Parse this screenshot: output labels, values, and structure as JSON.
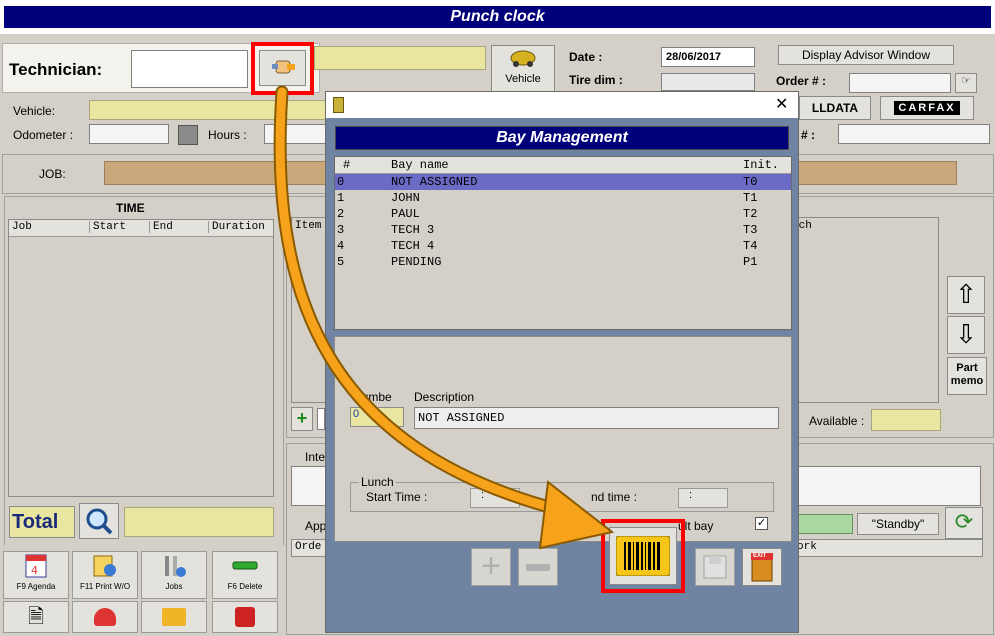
{
  "app": {
    "title": "Punch clock"
  },
  "header": {
    "technician_label": "Technician:",
    "technician_value": "",
    "vehicle_label": "Vehicle",
    "date_label": "Date :",
    "date_value": "28/06/2017",
    "tire_dim_label": "Tire dim :",
    "order_label": "Order # :",
    "display_advisor_button": "Display Advisor Window",
    "alldata_label": "LLDATA",
    "carfax_label": "CARFAX",
    "hash_label": "# :"
  },
  "vehicle_row": {
    "vehicle_label": "Vehicle:",
    "odometer_label": "Odometer :",
    "hours_label": "Hours :"
  },
  "job_row": {
    "label": "JOB:"
  },
  "time_panel": {
    "title": "TIME",
    "columns": [
      "Job",
      "Start",
      "End",
      "Duration"
    ],
    "total_label": "Total"
  },
  "items_panel": {
    "item_col": "Item",
    "tech_col": "ech",
    "part_memo": "Part memo",
    "available_label": "Available :",
    "standby_button": "\"Standby\"",
    "int_label": "Inte",
    "app_label": "App",
    "order_col": "Orde",
    "work_col": "ork"
  },
  "toolbar": {
    "agenda": "F9 Agenda",
    "print_wo": "F11 Print W/O",
    "jobs": "Jobs",
    "delete": "F6 Delete"
  },
  "dialog": {
    "title": "Bay Management",
    "columns": {
      "num": "#",
      "name": "Bay name",
      "init": "Init."
    },
    "rows": [
      {
        "num": "0",
        "name": "NOT ASSIGNED",
        "init": "T0"
      },
      {
        "num": "1",
        "name": "JOHN",
        "init": "T1"
      },
      {
        "num": "2",
        "name": "PAUL",
        "init": "T2"
      },
      {
        "num": "3",
        "name": "TECH 3",
        "init": "T3"
      },
      {
        "num": "4",
        "name": "TECH 4",
        "init": "T4"
      },
      {
        "num": "5",
        "name": "PENDING",
        "init": "P1"
      }
    ],
    "number_label": "Numbe",
    "number_value": "0",
    "description_label": "Description",
    "description_value": "NOT ASSIGNED",
    "lunch_label": "Lunch",
    "start_time_label": "Start Time :",
    "start_time_value": ":",
    "end_time_label": "nd time :",
    "end_time_value": ":",
    "default_bay_label": "ult bay",
    "default_bay_checked": "✓",
    "exit_label": "EXIT"
  },
  "colors": {
    "title_bg": "#00007a",
    "highlight_row": "#6b6bc6",
    "annotation_arrow": "#f7a21b",
    "annotation_box": "#ff0000"
  }
}
